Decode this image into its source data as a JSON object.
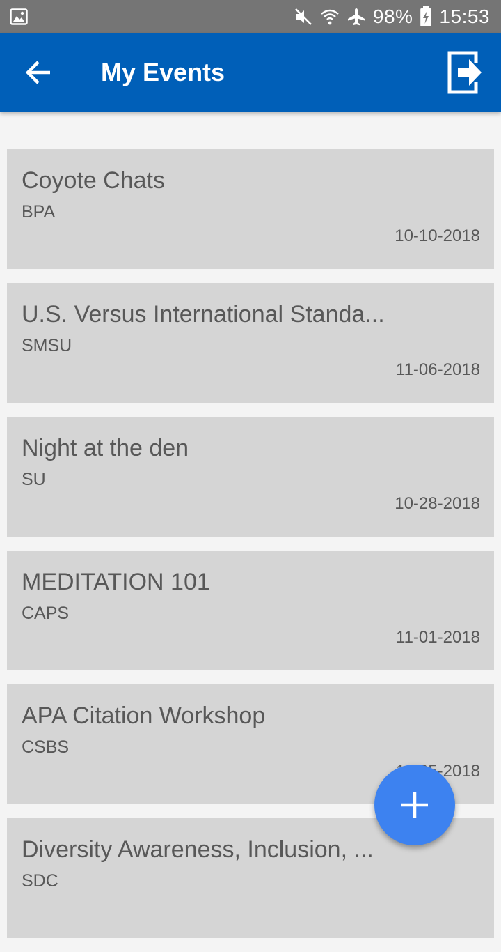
{
  "status_bar": {
    "battery": "98%",
    "time": "15:53",
    "icons": [
      "gallery-notification-icon",
      "mute-icon",
      "wifi-icon",
      "airplane-mode-icon",
      "battery-charging-icon"
    ]
  },
  "app_bar": {
    "title": "My Events",
    "back_icon": "arrow-back-icon",
    "exit_icon": "exit-icon",
    "color": "#005fb8"
  },
  "events": [
    {
      "title": "Coyote Chats",
      "org": "BPA",
      "date": "10-10-2018"
    },
    {
      "title": "U.S. Versus International Standa...",
      "org": "SMSU",
      "date": "11-06-2018"
    },
    {
      "title": "Night at the den",
      "org": "SU",
      "date": "10-28-2018"
    },
    {
      "title": "MEDITATION 101",
      "org": "CAPS",
      "date": "11-01-2018"
    },
    {
      "title": "APA Citation Workshop",
      "org": "CSBS",
      "date": "11-05-2018"
    },
    {
      "title": "Diversity Awareness, Inclusion, ...",
      "org": "SDC",
      "date": ""
    }
  ],
  "fab": {
    "icon": "plus-icon",
    "color": "#3d82f0"
  }
}
